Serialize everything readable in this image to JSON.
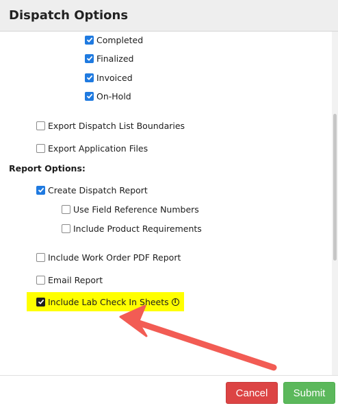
{
  "header": {
    "title": "Dispatch Options"
  },
  "status_filters": [
    {
      "label": "Completed",
      "checked": true
    },
    {
      "label": "Finalized",
      "checked": true
    },
    {
      "label": "Invoiced",
      "checked": true
    },
    {
      "label": "On-Hold",
      "checked": true
    }
  ],
  "export_options": [
    {
      "label": "Export Dispatch List Boundaries",
      "checked": false
    },
    {
      "label": "Export Application Files",
      "checked": false
    }
  ],
  "report_options": {
    "heading": "Report Options:",
    "create_dispatch_report": {
      "label": "Create Dispatch Report",
      "checked": true
    },
    "use_field_reference_numbers": {
      "label": "Use Field Reference Numbers",
      "checked": false
    },
    "include_product_requirements": {
      "label": "Include Product Requirements",
      "checked": false
    },
    "include_work_order_pdf": {
      "label": "Include Work Order PDF Report",
      "checked": false
    },
    "email_report": {
      "label": "Email Report",
      "checked": false
    },
    "include_lab_check_in_sheets": {
      "label": "Include Lab Check In Sheets",
      "checked": true,
      "info_icon": "info-circle-icon"
    }
  },
  "footer": {
    "cancel_label": "Cancel",
    "submit_label": "Submit"
  },
  "colors": {
    "checkbox_accent": "#1f7ae0",
    "highlight": "#ffff00",
    "arrow": "#f25c54",
    "cancel": "#dc4444",
    "submit": "#5cb85c"
  }
}
